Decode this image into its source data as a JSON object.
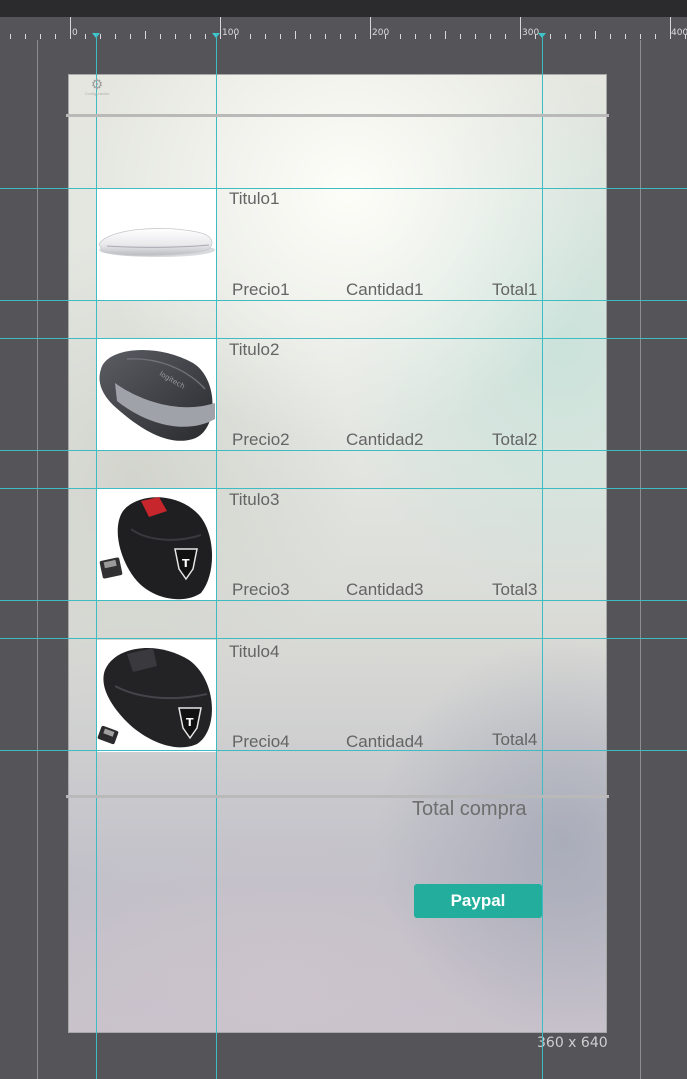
{
  "ruler": {
    "labels": [
      "0",
      "100",
      "200",
      "300",
      "400"
    ]
  },
  "artboard": {
    "size_label": "360 x 640"
  },
  "header": {
    "icon": "gear-icon",
    "icon_caption": "Configuración"
  },
  "products": [
    {
      "title": "Titulo1",
      "price": "Precio1",
      "quantity": "Cantidad1",
      "total": "Total1",
      "image": "magic-mouse-white"
    },
    {
      "title": "Titulo2",
      "price": "Precio2",
      "quantity": "Cantidad2",
      "total": "Total2",
      "image": "logitech-mouse-grey"
    },
    {
      "title": "Titulo3",
      "price": "Precio3",
      "quantity": "Cantidad3",
      "total": "Total3",
      "image": "wireless-mouse-red-accent"
    },
    {
      "title": "Titulo4",
      "price": "Precio4",
      "quantity": "Cantidad4",
      "total": "Total4",
      "image": "wireless-mouse-black"
    }
  ],
  "footer": {
    "total_label": "Total compra",
    "paypal_label": "Paypal"
  },
  "colors": {
    "accent": "#22ad9c",
    "guide": "#3fbcc2",
    "workspace": "#545459"
  }
}
